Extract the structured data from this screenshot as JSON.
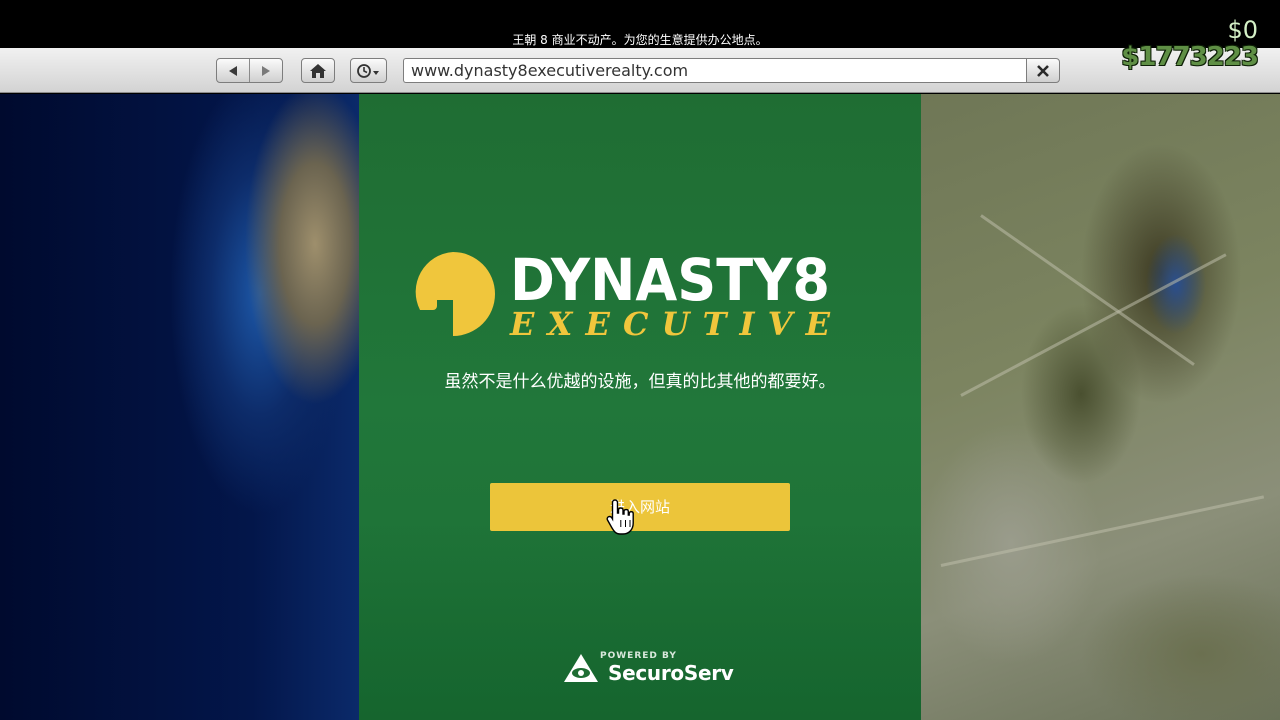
{
  "window": {
    "caption": "王朝 8 商业不动产。为您的生意提供办公地点。"
  },
  "toolbar": {
    "url": "www.dynasty8executiverealty.com",
    "back_icon": "back-arrow-icon",
    "forward_icon": "forward-arrow-icon",
    "home_icon": "home-icon",
    "history_icon": "history-clock-icon",
    "clear_icon": "close-icon"
  },
  "hud": {
    "cash": "$0",
    "bank": "$1773223"
  },
  "site": {
    "brand_main": "DYNASTY8",
    "brand_sub": "EXECUTIVE",
    "tagline": "虽然不是什么优越的设施，但真的比其他的都要好。",
    "enter_button": "进入网站",
    "powered_by": "POWERED BY",
    "powered_brand": "SecuroServ"
  },
  "colors": {
    "panel_green": "#21773a",
    "accent_yellow": "#ecc53a",
    "cash_green": "#5f8f45"
  }
}
